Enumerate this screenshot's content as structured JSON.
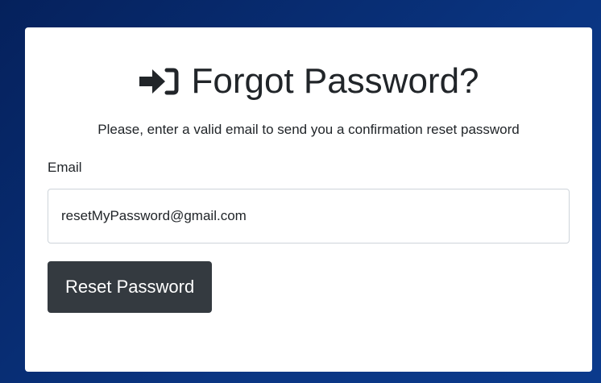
{
  "form": {
    "title": "Forgot Password?",
    "title_icon": "sign-in-arrow-icon",
    "subtitle": "Please, enter a valid email to send you a confirmation reset password",
    "email_label": "Email",
    "email_value": "resetMyPassword@gmail.com",
    "submit_label": "Reset Password"
  },
  "colors": {
    "background": "#0a3582",
    "card": "#ffffff",
    "text": "#212529",
    "button": "#343a40",
    "border": "#ced4da"
  }
}
